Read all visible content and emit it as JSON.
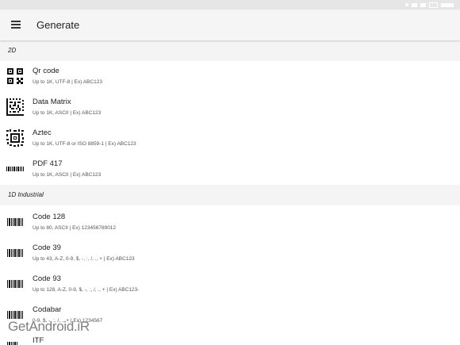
{
  "app_bar": {
    "title": "Generate",
    "menu_icon": "hamburger-menu-icon",
    "background": "#f5f5f5"
  },
  "sections": [
    {
      "label": "2D",
      "items": [
        {
          "title": "Qr code",
          "subtitle": "Up to 1K, UTF-8 | Ex) ABC123",
          "icon": "qr-code-icon"
        },
        {
          "title": "Data Matrix",
          "subtitle": "Up to 1K, ASCII | Ex) ABC123",
          "icon": "data-matrix-icon"
        },
        {
          "title": "Aztec",
          "subtitle": "Up to 1K, UTF-8 or ISO 8859-1 | Ex) ABC123",
          "icon": "aztec-icon"
        },
        {
          "title": "PDF 417",
          "subtitle": "Up to 1K, ASCII | Ex) ABC123",
          "icon": "pdf417-icon"
        }
      ]
    },
    {
      "label": "1D Industrial",
      "items": [
        {
          "title": "Code 128",
          "subtitle": "Up to 80, ASCII | Ex) 123456789012",
          "icon": "barcode-icon"
        },
        {
          "title": "Code 39",
          "subtitle": "Up to 43, A-Z, 0-9, $, -, :, /, ., + | Ex) ABC123",
          "icon": "barcode-icon"
        },
        {
          "title": "Code 93",
          "subtitle": "Up to 128, A-Z, 0-9, $, -, :, /, ., + | Ex) ABC123-",
          "icon": "barcode-icon"
        },
        {
          "title": "Codabar",
          "subtitle": "0-9, $, -, :, /, ., + | Ex) 1234567",
          "icon": "barcode-icon"
        },
        {
          "title": "ITF",
          "subtitle": "",
          "icon": "barcode-icon"
        }
      ]
    }
  ],
  "watermark": "GetAndroid.iR",
  "colors": {
    "section_background": "#f4f4f4",
    "status_bar": "#e6e6e6",
    "text_primary": "#212121",
    "text_secondary": "#555555"
  }
}
